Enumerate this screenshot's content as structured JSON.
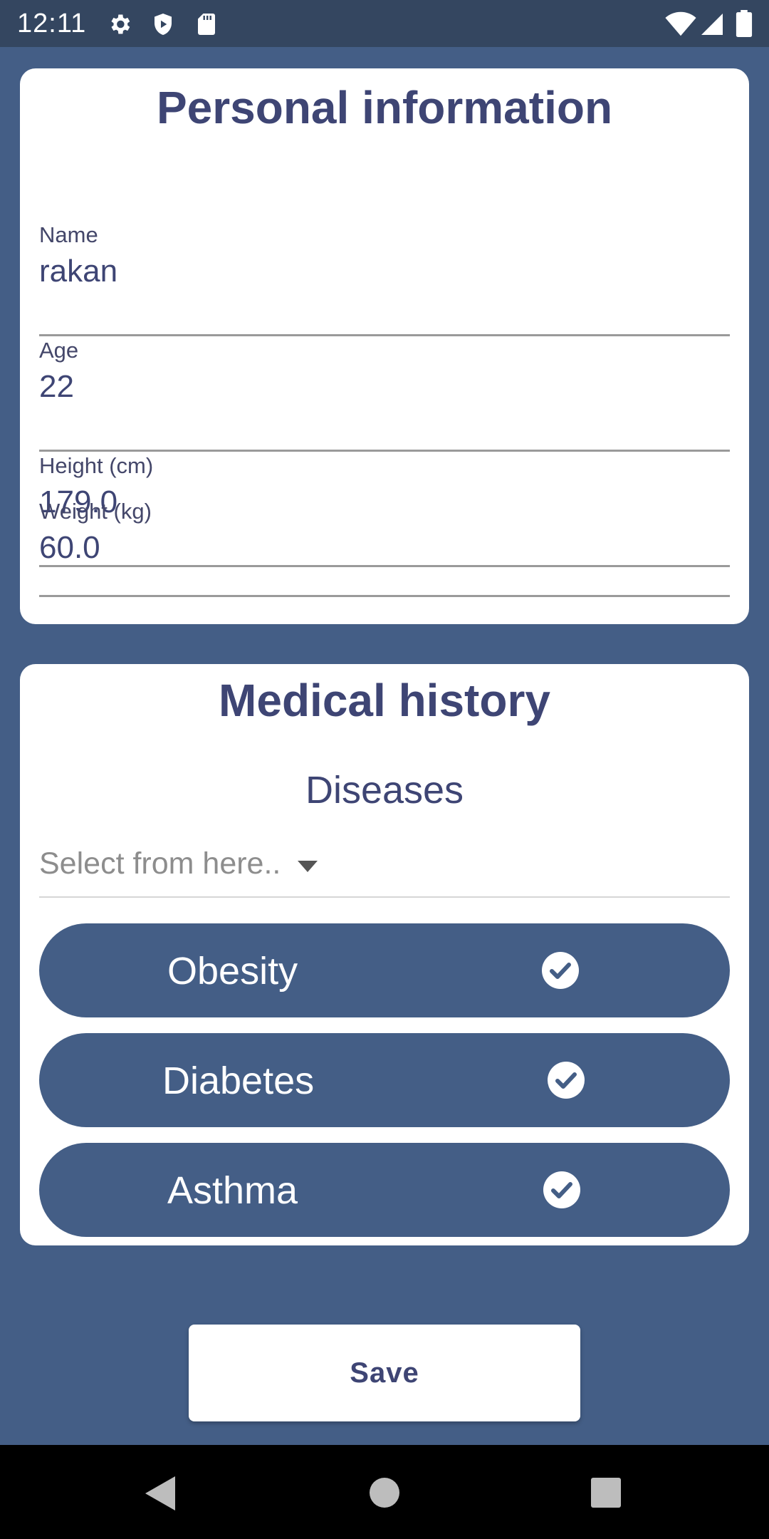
{
  "status_bar": {
    "time": "12:11",
    "icons": [
      "settings-icon",
      "shield-icon",
      "sd-card-icon",
      "wifi-icon",
      "signal-icon",
      "battery-icon"
    ]
  },
  "personal": {
    "title": "Personal information",
    "fields": [
      {
        "label": "Name",
        "value": "rakan"
      },
      {
        "label": "Age",
        "value": "22"
      },
      {
        "label": "Height (cm)",
        "value": "179.0"
      },
      {
        "label": "Weight (kg)",
        "value": "60.0"
      }
    ]
  },
  "medical": {
    "title": "Medical history",
    "diseases_heading": "Diseases",
    "select_placeholder": "Select from here..",
    "selected": [
      {
        "label": "Obesity",
        "checked": true
      },
      {
        "label": "Diabetes",
        "checked": true
      },
      {
        "label": "Asthma",
        "checked": true
      }
    ]
  },
  "save_label": "Save",
  "nav": {
    "back": "back-icon",
    "home": "home-icon",
    "recents": "recents-icon"
  },
  "colors": {
    "background": "#445e86",
    "status_bar": "#344660",
    "card": "#ffffff",
    "title_text": "#3e4574",
    "chip": "#445e86",
    "nav_bar": "#000000"
  }
}
